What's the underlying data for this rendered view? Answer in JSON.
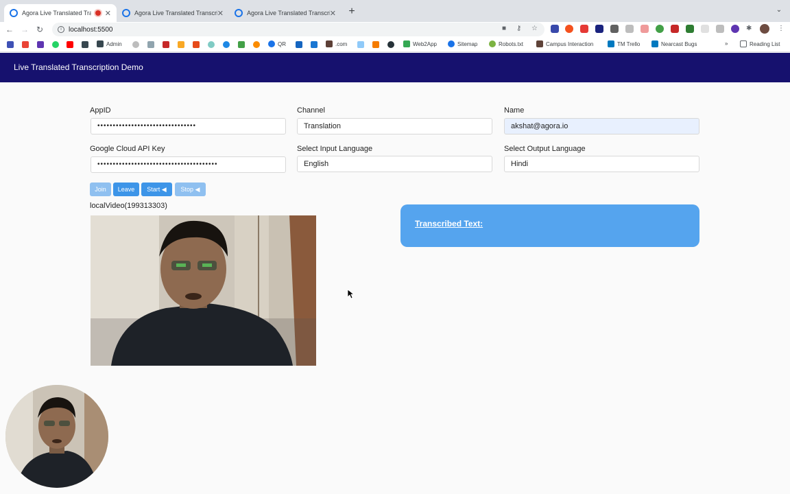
{
  "browser": {
    "tabs": [
      {
        "title": "Agora Live Translated Transcription Demo",
        "recording": true,
        "active": true
      },
      {
        "title": "Agora Live Translated Transcription Demo",
        "recording": false,
        "active": false
      },
      {
        "title": "Agora Live Translated Transcription Demo",
        "recording": false,
        "active": false
      }
    ],
    "url": "localhost:5500",
    "bookmarks": [
      {
        "label": "Admin",
        "color": "#3c4043"
      },
      {
        "label": "QR",
        "color": "#1a73e8"
      },
      {
        "label": ".com",
        "color": "#5f6368"
      },
      {
        "label": "Web2App",
        "color": "#34a853"
      },
      {
        "label": "Sitemap",
        "color": "#1a73e8"
      },
      {
        "label": "Robots.txt",
        "color": "#7cb342"
      },
      {
        "label": "Campus Interaction",
        "color": "#5f4339"
      },
      {
        "label": "TM Trello",
        "color": "#0079bf"
      },
      {
        "label": "Nearcast Bugs",
        "color": "#0079bf"
      }
    ],
    "reading_list": "Reading List"
  },
  "app": {
    "title": "Live Translated Transcription Demo",
    "form": {
      "appid_label": "AppID",
      "appid_value": "••••••••••••••••••••••••••••••••",
      "channel_label": "Channel",
      "channel_value": "Translation",
      "name_label": "Name",
      "name_value": "akshat@agora.io",
      "apikey_label": "Google Cloud API Key",
      "apikey_value": "•••••••••••••••••••••••••••••••••••••••",
      "input_lang_label": "Select Input Language",
      "input_lang_value": "English",
      "output_lang_label": "Select Output Language",
      "output_lang_value": "Hindi"
    },
    "buttons": {
      "join": "Join",
      "leave": "Leave",
      "start": "Start",
      "stop": "Stop"
    },
    "local_video_label": "localVideo(199313303)",
    "transcribed_title": "Transcribed Text:"
  },
  "colors": {
    "appbar": "#16116e",
    "button": "#3d95e8",
    "button_disabled": "#8fc0f0",
    "transcript_box": "#55a4ee"
  }
}
